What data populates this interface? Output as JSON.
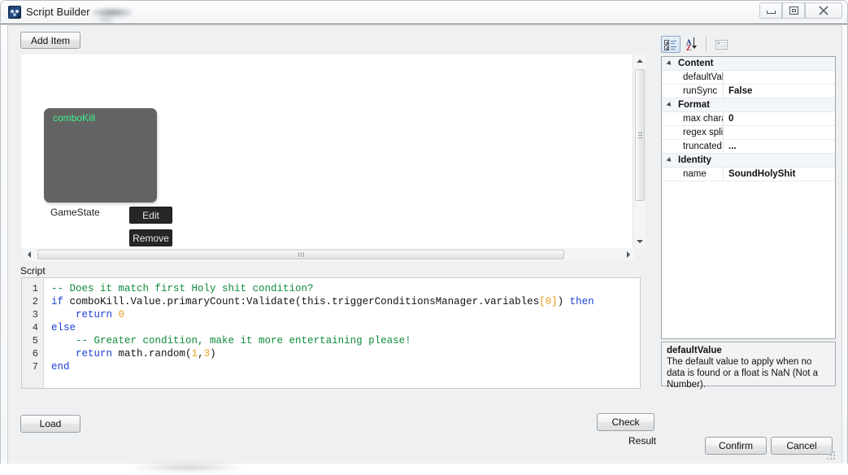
{
  "window": {
    "title": "Script Builder",
    "icon": "app-icon",
    "controls": {
      "minimize": "minimize-icon",
      "maximize": "maximize-icon",
      "close": "close-icon"
    }
  },
  "toolbar": {
    "add_item_label": "Add Item"
  },
  "canvas": {
    "node": {
      "title": "comboKill",
      "field_label": "GameState",
      "edit_label": "Edit",
      "remove_label": "Remove"
    },
    "scroll": {
      "up_icon": "arrow-up-icon",
      "down_icon": "arrow-down-icon",
      "left_icon": "arrow-left-icon",
      "right_icon": "arrow-right-icon"
    }
  },
  "script": {
    "label": "Script",
    "line_numbers": [
      "1",
      "2",
      "3",
      "4",
      "5",
      "6",
      "7"
    ],
    "lines": [
      [
        {
          "t": "-- Does it match first Holy shit condition?",
          "c": "cmt"
        }
      ],
      [
        {
          "t": "if",
          "c": "kw"
        },
        {
          "t": " comboKill.Value.primaryCount:Validate(this.triggerConditionsManager.variables",
          "c": "pln"
        },
        {
          "t": "[0]",
          "c": "num"
        },
        {
          "t": ") ",
          "c": "pln"
        },
        {
          "t": "then",
          "c": "kw"
        }
      ],
      [
        {
          "t": "    ",
          "c": "pln"
        },
        {
          "t": "return",
          "c": "kw"
        },
        {
          "t": " ",
          "c": "pln"
        },
        {
          "t": "0",
          "c": "num"
        }
      ],
      [
        {
          "t": "else",
          "c": "kw"
        }
      ],
      [
        {
          "t": "    ",
          "c": "pln"
        },
        {
          "t": "-- Greater condition, make it more entertaining please!",
          "c": "cmt"
        }
      ],
      [
        {
          "t": "    ",
          "c": "pln"
        },
        {
          "t": "return",
          "c": "kw"
        },
        {
          "t": " math.random(",
          "c": "pln"
        },
        {
          "t": "1",
          "c": "num"
        },
        {
          "t": ",",
          "c": "pln"
        },
        {
          "t": "3",
          "c": "num"
        },
        {
          "t": ")",
          "c": "pln"
        }
      ],
      [
        {
          "t": "end",
          "c": "kw"
        }
      ]
    ]
  },
  "actions": {
    "load_label": "Load",
    "check_label": "Check",
    "result_label": "Result",
    "confirm_label": "Confirm",
    "cancel_label": "Cancel"
  },
  "properties": {
    "toolbar": {
      "categorized_icon": "categorized-view-icon",
      "alphabetical_icon": "alphabetical-sort-icon",
      "pages_icon": "property-pages-icon",
      "alpha_a": "A",
      "alpha_z": "Z"
    },
    "rows": [
      {
        "kind": "category",
        "name": "Content"
      },
      {
        "kind": "item",
        "name": "defaultValue",
        "value": ""
      },
      {
        "kind": "item",
        "name": "runSync",
        "value": "False"
      },
      {
        "kind": "category",
        "name": "Format"
      },
      {
        "kind": "item",
        "name": "max characters",
        "value": "0"
      },
      {
        "kind": "item",
        "name": "regex split",
        "value": ""
      },
      {
        "kind": "item",
        "name": "truncatedString",
        "value": "..."
      },
      {
        "kind": "category",
        "name": "Identity"
      },
      {
        "kind": "item",
        "name": "name",
        "value": "SoundHolyShit"
      }
    ],
    "help": {
      "title": "defaultValue",
      "description": "The default value to apply when no data is found or a float is NaN (Not a Number)."
    }
  },
  "colors": {
    "node_bg": "#636363",
    "node_title": "#3ef38a",
    "comment": "#0f8a3c",
    "keyword": "#1a3fd6",
    "number": "#e6a020"
  }
}
